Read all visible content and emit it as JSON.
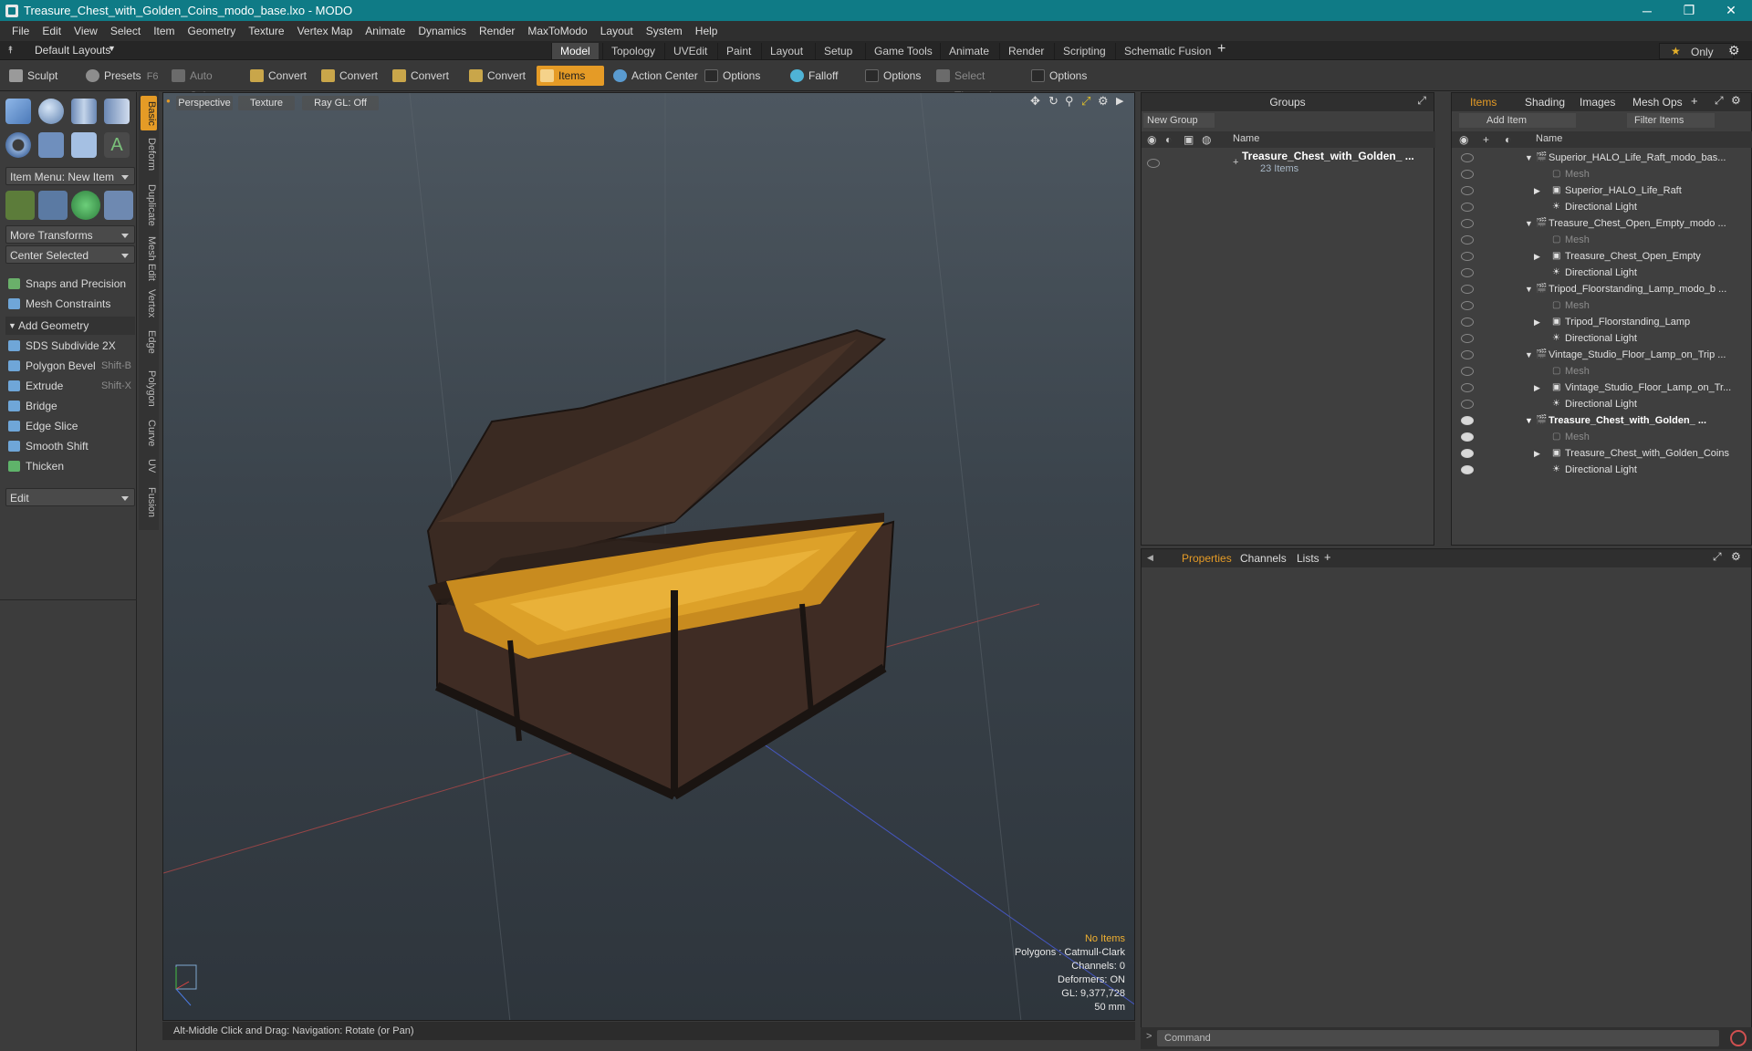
{
  "window": {
    "title": "Treasure_Chest_with_Golden_Coins_modo_base.lxo - MODO",
    "controls": [
      "─",
      "❐",
      "✕"
    ]
  },
  "menu": [
    "File",
    "Edit",
    "View",
    "Select",
    "Item",
    "Geometry",
    "Texture",
    "Vertex Map",
    "Animate",
    "Dynamics",
    "Render",
    "MaxToModo",
    "Layout",
    "System",
    "Help"
  ],
  "layoutbar": {
    "layout_label": "Default Layouts",
    "tabs": [
      "Model",
      "Topology",
      "UVEdit",
      "Paint",
      "Layout",
      "Setup",
      "Game Tools",
      "Animate",
      "Render",
      "Scripting",
      "Schematic Fusion"
    ],
    "active_tab": "Model",
    "only_label": "Only"
  },
  "toolbar": {
    "sculpt": "Sculpt",
    "presets": "Presets",
    "presets_key": "F6",
    "auto_select": "Auto Select",
    "convert": "Convert",
    "items": "Items",
    "action_center": "Action Center",
    "options": "Options",
    "falloff": "Falloff",
    "select_through": "Select Through"
  },
  "leftpanel": {
    "item_menu": "Item Menu: New Item",
    "more_transforms": "More Transforms",
    "center_selected": "Center Selected",
    "snaps": "Snaps and Precision",
    "mesh_constraints": "Mesh Constraints",
    "add_geometry": "Add Geometry",
    "tools": [
      {
        "label": "SDS Subdivide 2X",
        "key": ""
      },
      {
        "label": "Polygon Bevel",
        "key": "Shift-B"
      },
      {
        "label": "Extrude",
        "key": "Shift-X"
      },
      {
        "label": "Bridge",
        "key": ""
      },
      {
        "label": "Edge Slice",
        "key": ""
      },
      {
        "label": "Smooth Shift",
        "key": ""
      },
      {
        "label": "Thicken",
        "key": ""
      }
    ],
    "edit": "Edit"
  },
  "vtabs": [
    "Basic",
    "Deform",
    "Duplicate",
    "Mesh Edit",
    "Vertex",
    "Edge",
    "Polygon",
    "Curve",
    "UV",
    "Fusion"
  ],
  "viewport": {
    "view": "Perspective",
    "shading": "Texture",
    "raygl": "Ray GL: Off",
    "info": {
      "selection": "No Items",
      "polygons": "Polygons : Catmull-Clark",
      "channels": "Channels: 0",
      "deformers": "Deformers: ON",
      "gl": "GL: 9,377,728",
      "scale": "50 mm"
    }
  },
  "status": "Alt-Middle Click and Drag:   Navigation: Rotate (or Pan)",
  "groups": {
    "title": "Groups",
    "new_group": "New Group",
    "col_name": "Name",
    "group_name": "Treasure_Chest_with_Golden_ ...",
    "group_count": "23 Items"
  },
  "items_panel": {
    "tabs": [
      "Items",
      "Shading",
      "Images",
      "Mesh Ops"
    ],
    "add_item": "Add Item",
    "filter": "Filter Items",
    "col_name": "Name",
    "rows": [
      {
        "label": "Superior_HALO_Life_Raft_modo_bas...",
        "kind": "scene",
        "dim": false,
        "bold": false
      },
      {
        "label": "Mesh",
        "kind": "mesh",
        "dim": true,
        "bold": false
      },
      {
        "label": "Superior_HALO_Life_Raft",
        "kind": "item",
        "dim": false,
        "bold": false
      },
      {
        "label": "Directional Light",
        "kind": "light",
        "dim": false,
        "bold": false
      },
      {
        "label": "Treasure_Chest_Open_Empty_modo ...",
        "kind": "scene",
        "dim": false,
        "bold": false
      },
      {
        "label": "Mesh",
        "kind": "mesh",
        "dim": true,
        "bold": false
      },
      {
        "label": "Treasure_Chest_Open_Empty",
        "kind": "item",
        "dim": false,
        "bold": false
      },
      {
        "label": "Directional Light",
        "kind": "light",
        "dim": false,
        "bold": false
      },
      {
        "label": "Tripod_Floorstanding_Lamp_modo_b ...",
        "kind": "scene",
        "dim": false,
        "bold": false
      },
      {
        "label": "Mesh",
        "kind": "mesh",
        "dim": true,
        "bold": false
      },
      {
        "label": "Tripod_Floorstanding_Lamp",
        "kind": "item",
        "dim": false,
        "bold": false
      },
      {
        "label": "Directional Light",
        "kind": "light",
        "dim": false,
        "bold": false
      },
      {
        "label": "Vintage_Studio_Floor_Lamp_on_Trip ...",
        "kind": "scene",
        "dim": false,
        "bold": false
      },
      {
        "label": "Mesh",
        "kind": "mesh",
        "dim": true,
        "bold": false
      },
      {
        "label": "Vintage_Studio_Floor_Lamp_on_Tr...",
        "kind": "item",
        "dim": false,
        "bold": false
      },
      {
        "label": "Directional Light",
        "kind": "light",
        "dim": false,
        "bold": false
      },
      {
        "label": "Treasure_Chest_with_Golden_ ...",
        "kind": "scene",
        "dim": false,
        "bold": true
      },
      {
        "label": "Mesh",
        "kind": "mesh",
        "dim": true,
        "bold": false
      },
      {
        "label": "Treasure_Chest_with_Golden_Coins",
        "kind": "item",
        "dim": false,
        "bold": false
      },
      {
        "label": "Directional Light",
        "kind": "light",
        "dim": false,
        "bold": false
      }
    ]
  },
  "properties": {
    "tabs": [
      "Properties",
      "Channels",
      "Lists"
    ]
  },
  "command": {
    "placeholder": "Command"
  },
  "colors": {
    "accent": "#e59b26",
    "titlebar": "#0f7b86"
  }
}
